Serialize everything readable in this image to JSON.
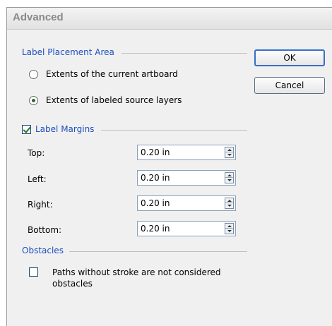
{
  "window": {
    "title": "Advanced"
  },
  "placement": {
    "title": "Label Placement Area",
    "options": [
      {
        "label": "Extents of the current artboard",
        "selected": false
      },
      {
        "label": "Extents of labeled source layers",
        "selected": true
      }
    ]
  },
  "margins": {
    "title": "Label Margins",
    "enabled": true,
    "fields": [
      {
        "label": "Top:",
        "value": "0.20 in"
      },
      {
        "label": "Left:",
        "value": "0.20 in"
      },
      {
        "label": "Right:",
        "value": "0.20 in"
      },
      {
        "label": "Bottom:",
        "value": "0.20 in"
      }
    ]
  },
  "obstacles": {
    "title": "Obstacles",
    "checkbox_label": "Paths without stroke are not considered\nobstacles",
    "checked": false
  },
  "buttons": {
    "ok": "OK",
    "cancel": "Cancel"
  }
}
